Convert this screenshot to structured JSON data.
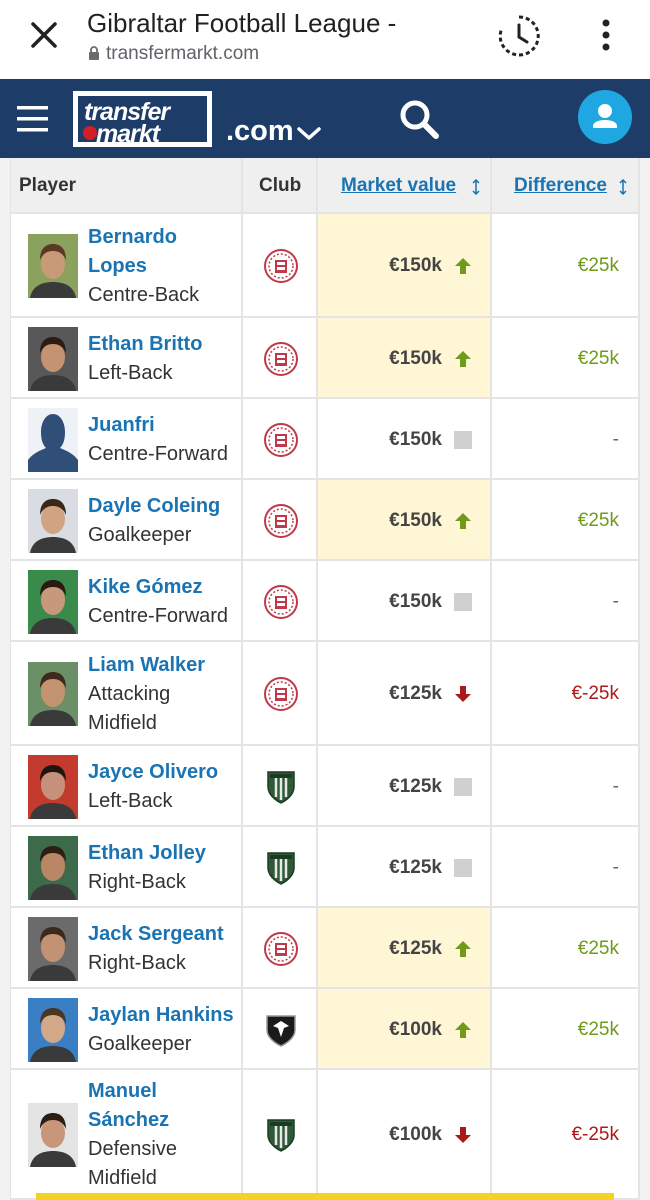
{
  "browser": {
    "title": "Gibraltar Football League -",
    "url": "transfermarkt.com"
  },
  "site": {
    "logo_line1": "transfer",
    "logo_line2": "markt",
    "domain_suffix": ".com"
  },
  "table": {
    "headers": {
      "player": "Player",
      "club": "Club",
      "market_value": "Market value",
      "difference": "Difference"
    },
    "rows": [
      {
        "name_lines": [
          "Bernardo",
          "Lopes"
        ],
        "position_lines": [
          "Centre-Back"
        ],
        "club": "lincoln",
        "market_value": "€150k",
        "trend": "up",
        "difference": "€25k"
      },
      {
        "name_lines": [
          "Ethan Britto"
        ],
        "position_lines": [
          "Left-Back"
        ],
        "club": "lincoln",
        "market_value": "€150k",
        "trend": "up",
        "difference": "€25k"
      },
      {
        "name_lines": [
          "Juanfri"
        ],
        "position_lines": [
          "Centre-Forward"
        ],
        "club": "lincoln",
        "market_value": "€150k",
        "trend": "same",
        "difference": "-"
      },
      {
        "name_lines": [
          "Dayle Coleing"
        ],
        "position_lines": [
          "Goalkeeper"
        ],
        "club": "lincoln",
        "market_value": "€150k",
        "trend": "up",
        "difference": "€25k"
      },
      {
        "name_lines": [
          "Kike Gómez"
        ],
        "position_lines": [
          "Centre-Forward"
        ],
        "club": "lincoln",
        "market_value": "€150k",
        "trend": "same",
        "difference": "-"
      },
      {
        "name_lines": [
          "Liam Walker"
        ],
        "position_lines": [
          "Attacking",
          "Midfield"
        ],
        "club": "lincoln",
        "market_value": "€125k",
        "trend": "down",
        "difference": "€-25k"
      },
      {
        "name_lines": [
          "Jayce Olivero"
        ],
        "position_lines": [
          "Left-Back"
        ],
        "club": "europa",
        "market_value": "€125k",
        "trend": "same",
        "difference": "-"
      },
      {
        "name_lines": [
          "Ethan Jolley"
        ],
        "position_lines": [
          "Right-Back"
        ],
        "club": "europa",
        "market_value": "€125k",
        "trend": "same",
        "difference": "-"
      },
      {
        "name_lines": [
          "Jack Sergeant"
        ],
        "position_lines": [
          "Right-Back"
        ],
        "club": "lincoln",
        "market_value": "€125k",
        "trend": "up",
        "difference": "€25k"
      },
      {
        "name_lines": [
          "Jaylan Hankins"
        ],
        "position_lines": [
          "Goalkeeper"
        ],
        "club": "st-josephs",
        "market_value": "€100k",
        "trend": "up",
        "difference": "€25k"
      },
      {
        "name_lines": [
          "Manuel",
          "Sánchez"
        ],
        "position_lines": [
          "Defensive",
          "Midfield"
        ],
        "club": "europa",
        "market_value": "€100k",
        "trend": "down",
        "difference": "€-25k"
      }
    ]
  },
  "colors": {
    "navbar": "#1d3c67",
    "link": "#1a74b3",
    "up": "#6f9a1c",
    "down": "#ab1a1a",
    "highlight": "#fff6d6"
  }
}
